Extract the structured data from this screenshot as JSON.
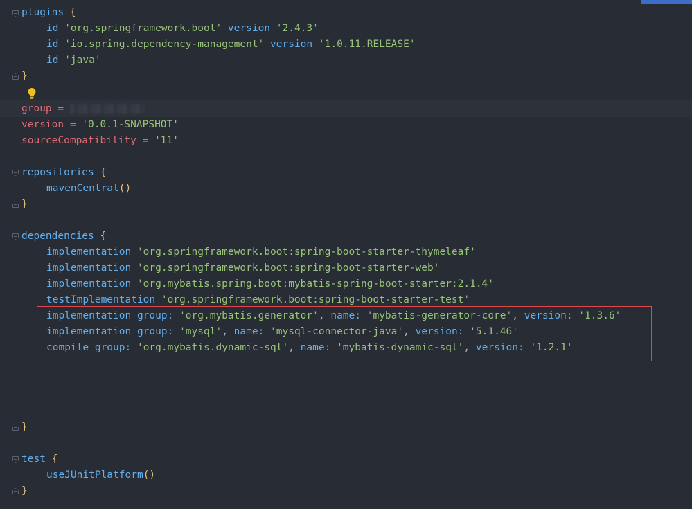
{
  "editor": {
    "file_language": "Gradle (Groovy)"
  },
  "code": {
    "plugins_keyword": "plugins",
    "plugins": [
      {
        "id_kw": "id",
        "id": "'org.springframework.boot'",
        "version_kw": "version",
        "version": "'2.4.3'"
      },
      {
        "id_kw": "id",
        "id": "'io.spring.dependency-management'",
        "version_kw": "version",
        "version": "'1.0.11.RELEASE'"
      },
      {
        "id_kw": "id",
        "id": "'java'"
      }
    ],
    "group_key": "group",
    "group_eq": "=",
    "version_key": "version",
    "version_eq": "=",
    "version_value": "'0.0.1-SNAPSHOT'",
    "sourceCompat_key": "sourceCompatibility",
    "sourceCompat_eq": "=",
    "sourceCompat_value": "'11'",
    "repositories_keyword": "repositories",
    "mavenCentral": "mavenCentral",
    "parens": "()",
    "dependencies_keyword": "dependencies",
    "deps": [
      {
        "config": "implementation",
        "value": "'org.springframework.boot:spring-boot-starter-thymeleaf'"
      },
      {
        "config": "implementation",
        "value": "'org.springframework.boot:spring-boot-starter-web'"
      },
      {
        "config": "implementation",
        "value": "'org.mybatis.spring.boot:mybatis-spring-boot-starter:2.1.4'"
      },
      {
        "config": "testImplementation",
        "value": "'org.springframework.boot:spring-boot-starter-test'"
      }
    ],
    "highlighted_deps": [
      {
        "config": "implementation",
        "group": "'org.mybatis.generator'",
        "name": "'mybatis-generator-core'",
        "version": "'1.3.6'"
      },
      {
        "config": "implementation",
        "group": "'mysql'",
        "name": "'mysql-connector-java'",
        "version": "'5.1.46'"
      },
      {
        "config": "compile",
        "group": "'org.mybatis.dynamic-sql'",
        "name": "'mybatis-dynamic-sql'",
        "version": "'1.2.1'"
      }
    ],
    "label_group": "group:",
    "label_name": "name:",
    "label_version": "version:",
    "comma": ",",
    "test_keyword": "test",
    "useJUnitPlatform": "useJUnitPlatform",
    "open_brace": "{",
    "close_brace": "}"
  },
  "colors": {
    "background": "#282c34",
    "keyword": "#61afef",
    "property": "#e06c75",
    "string": "#98c379",
    "brace": "#e5c07b",
    "highlight_border": "#e0474c"
  }
}
